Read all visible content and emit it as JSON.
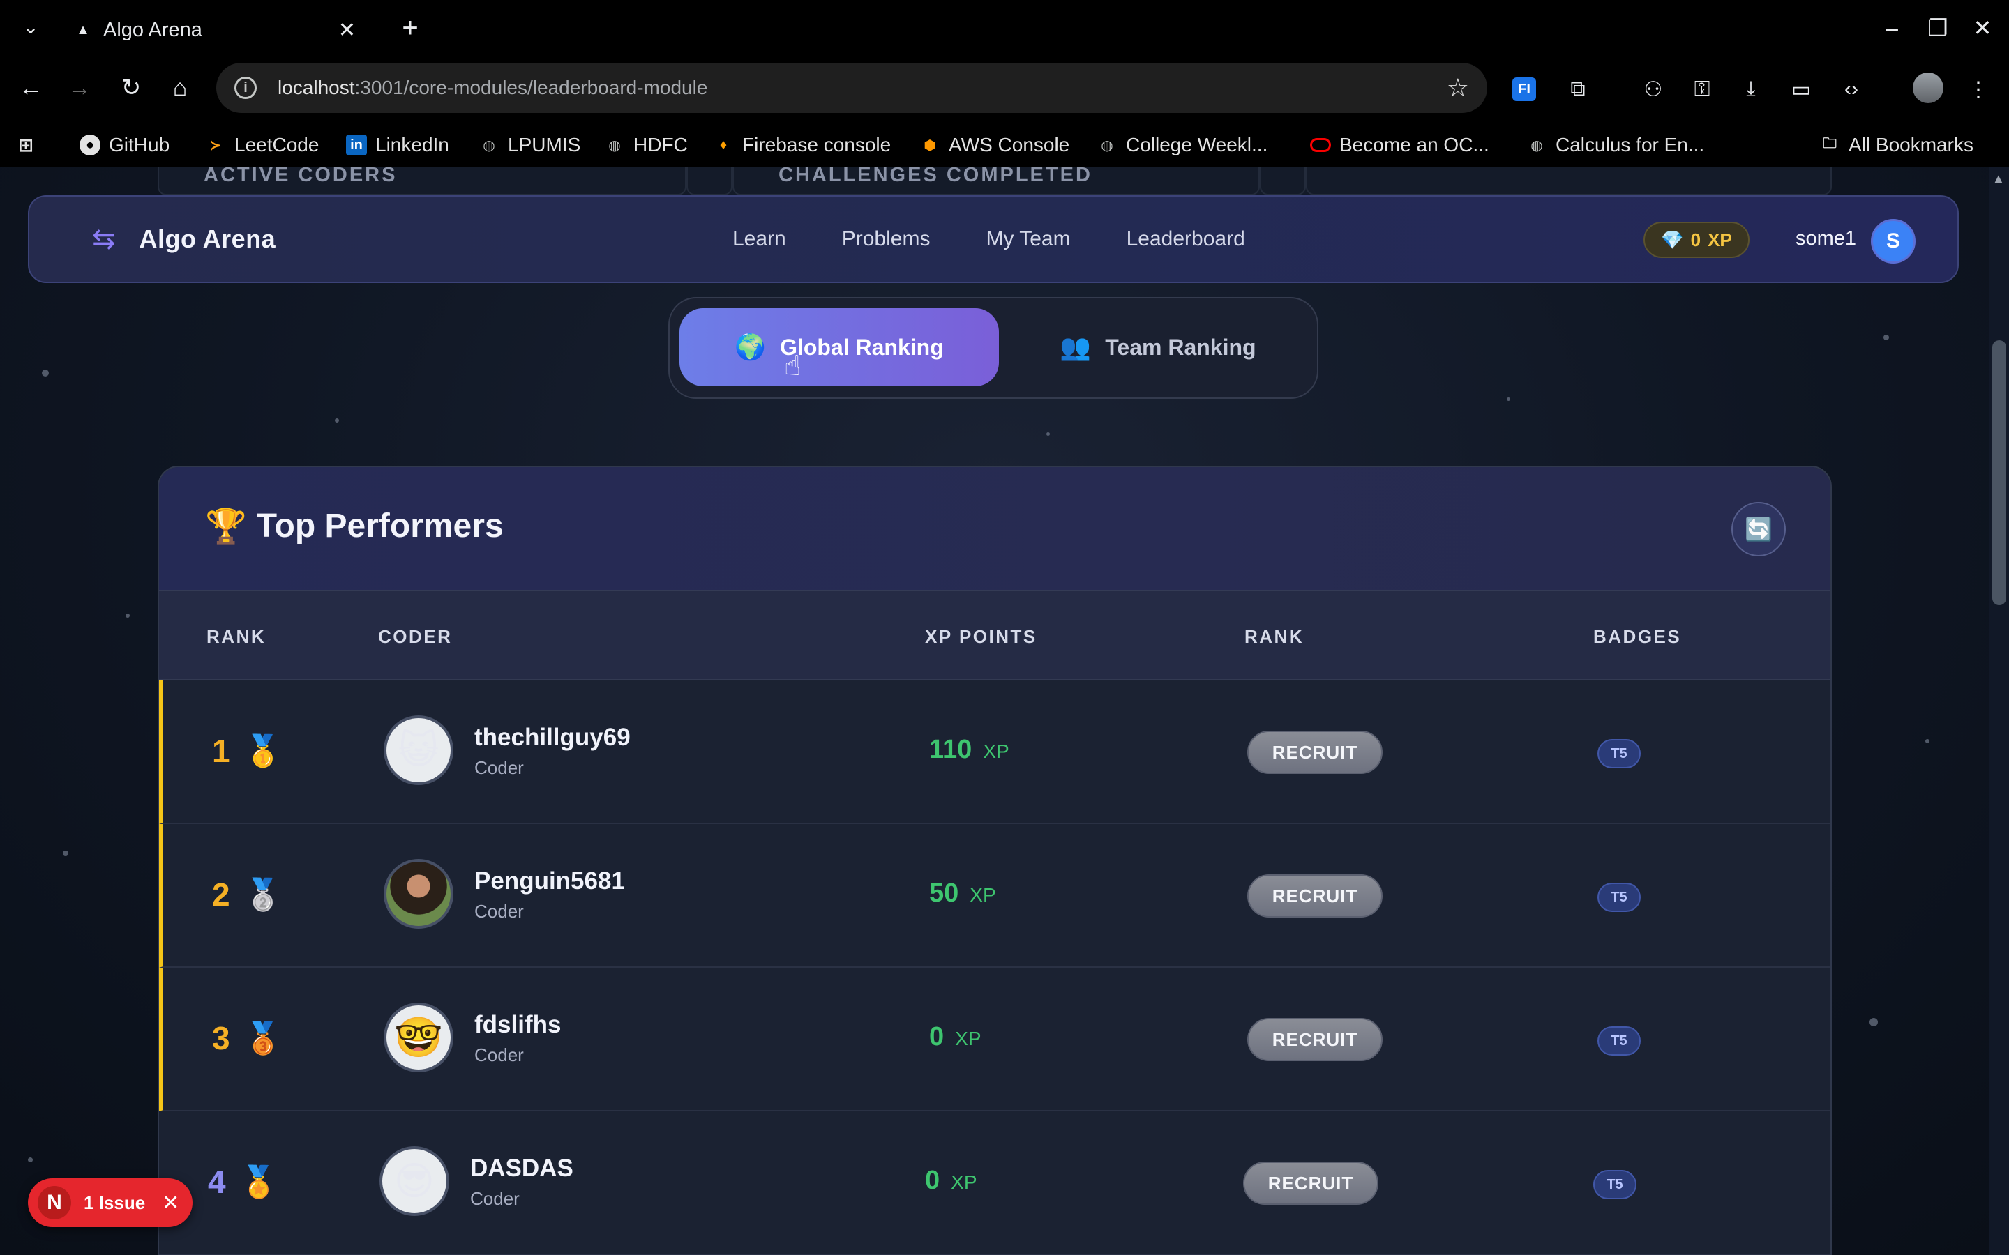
{
  "browser": {
    "tab_title": "Algo Arena",
    "url_host": "localhost",
    "url_path": ":3001/core-modules/leaderboard-module",
    "bookmarks": [
      {
        "label": "GitHub",
        "icon": "github-icon"
      },
      {
        "label": "LeetCode",
        "icon": "leetcode-icon"
      },
      {
        "label": "LinkedIn",
        "icon": "linkedin-icon"
      },
      {
        "label": "LPUMIS",
        "icon": "globe-icon"
      },
      {
        "label": "HDFC",
        "icon": "globe-icon"
      },
      {
        "label": "Firebase console",
        "icon": "firebase-icon"
      },
      {
        "label": "AWS Console",
        "icon": "aws-icon"
      },
      {
        "label": "College Weekl...",
        "icon": "globe-icon"
      },
      {
        "label": "Become an OC...",
        "icon": "oracle-icon"
      },
      {
        "label": "Calculus for En...",
        "icon": "globe-icon"
      }
    ],
    "all_bookmarks": "All Bookmarks"
  },
  "stats_strip": [
    "ACTIVE CODERS",
    "CHALLENGES COMPLETED",
    ""
  ],
  "navbar": {
    "brand": "Algo Arena",
    "links": [
      "Learn",
      "Problems",
      "My Team",
      "Leaderboard"
    ],
    "xp_value": "0",
    "xp_unit": "XP",
    "username": "some1",
    "avatar_initial": "S"
  },
  "toggle": {
    "global": "Global Ranking",
    "team": "Team Ranking"
  },
  "board": {
    "title": "Top Performers",
    "columns": [
      "RANK",
      "CODER",
      "XP POINTS",
      "RANK",
      "BADGES"
    ],
    "rows": [
      {
        "rank": "1",
        "medal": "🥇",
        "name": "thechillguy69",
        "role": "Coder",
        "xp": "110",
        "xp_unit": "XP",
        "action": "RECRUIT",
        "badge": "T5"
      },
      {
        "rank": "2",
        "medal": "🥈",
        "name": "Penguin5681",
        "role": "Coder",
        "xp": "50",
        "xp_unit": "XP",
        "action": "RECRUIT",
        "badge": "T5"
      },
      {
        "rank": "3",
        "medal": "🥉",
        "name": "fdslifhs",
        "role": "Coder",
        "xp": "0",
        "xp_unit": "XP",
        "action": "RECRUIT",
        "badge": "T5"
      },
      {
        "rank": "4",
        "medal": "🏅",
        "name": "DASDAS",
        "role": "Coder",
        "xp": "0",
        "xp_unit": "XP",
        "action": "RECRUIT",
        "badge": "T5"
      }
    ]
  },
  "dev_overlay": {
    "logo": "N",
    "issues": "1 Issue"
  },
  "colors": {
    "accent_purple": "#7a5fd8",
    "xp_green": "#3ec56f",
    "gold": "#f5b025",
    "issue_red": "#e5262d"
  }
}
